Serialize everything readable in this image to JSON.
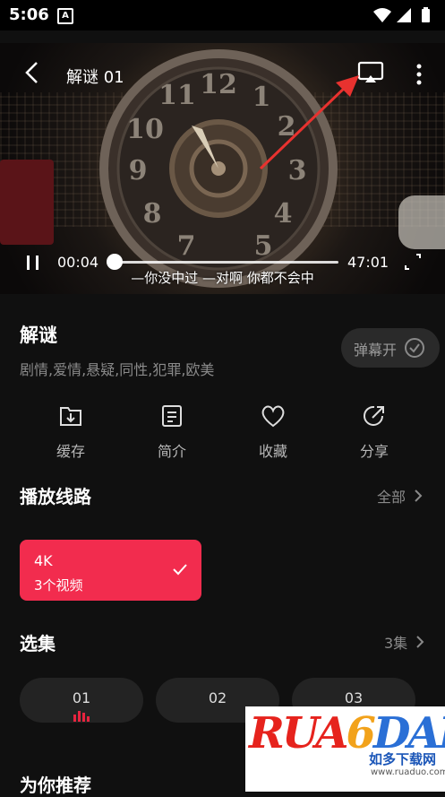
{
  "status_bar": {
    "time": "5:06",
    "notification_icon": "A"
  },
  "player": {
    "title": "解谜 01",
    "current_time": "00:04",
    "duration": "47:01",
    "subtitle": "—你没中过 —对啊 你都不会中",
    "progress_fraction": 0.001
  },
  "info": {
    "title": "解谜",
    "tags": "剧情,爱情,悬疑,同性,犯罪,欧美",
    "danmaku_label": "弹幕开"
  },
  "actions": [
    {
      "icon": "download-icon",
      "label": "缓存"
    },
    {
      "icon": "document-icon",
      "label": "简介"
    },
    {
      "icon": "heart-icon",
      "label": "收藏"
    },
    {
      "icon": "share-icon",
      "label": "分享"
    }
  ],
  "lines": {
    "heading": "播放线路",
    "all_label": "全部",
    "selected": {
      "quality": "4K",
      "count": "3个视频"
    }
  },
  "episodes": {
    "heading": "选集",
    "count_label": "3集",
    "items": [
      "01",
      "02",
      "03"
    ],
    "playing_index": 0
  },
  "recommend": {
    "heading": "为你推荐"
  },
  "watermark": {
    "brand": "RUANDADO",
    "tagline": "如多下载网",
    "url": "www.ruaduo.com"
  },
  "colors": {
    "accent": "#f22c4e",
    "background": "#101010",
    "arrow": "#e8322f"
  }
}
